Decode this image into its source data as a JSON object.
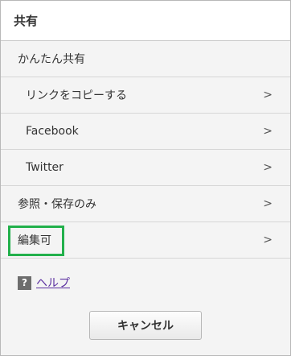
{
  "dialog": {
    "title": "共有"
  },
  "sections": {
    "easy_share": "かんたん共有",
    "copy_link": "リンクをコピーする",
    "facebook": "Facebook",
    "twitter": "Twitter",
    "view_only": "参照・保存のみ",
    "editable": "編集可"
  },
  "chevron": ">",
  "help": {
    "icon_glyph": "?",
    "label": "ヘルプ"
  },
  "buttons": {
    "cancel": "キャンセル"
  },
  "colors": {
    "highlight": "#22b04b",
    "help_link": "#5b2fa0"
  }
}
